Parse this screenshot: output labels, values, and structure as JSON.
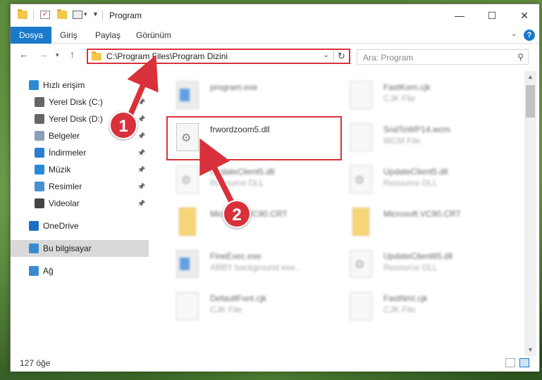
{
  "window": {
    "title": "Program",
    "controls": {
      "minimize": "—",
      "maximize": "☐",
      "close": "✕"
    }
  },
  "ribbon": {
    "tabs": [
      {
        "label": "Dosya",
        "active": true
      },
      {
        "label": "Giriş"
      },
      {
        "label": "Paylaş"
      },
      {
        "label": "Görünüm"
      }
    ],
    "help": "?"
  },
  "address": {
    "path": "C:\\Program Files\\Program Dizini",
    "search_placeholder": "Ara: Program"
  },
  "sidebar": {
    "items": [
      {
        "label": "Hızlı erişim",
        "icon": "star-icon",
        "color": "#2b8ad6",
        "pinned": false
      },
      {
        "label": "Yerel Disk (C:)",
        "icon": "drive-icon",
        "color": "#666666",
        "pinned": true
      },
      {
        "label": "Yerel Disk (D:)",
        "icon": "drive-icon",
        "color": "#666666",
        "pinned": true
      },
      {
        "label": "Belgeler",
        "icon": "documents-icon",
        "color": "#8aa0b8",
        "pinned": true
      },
      {
        "label": "İndirmeler",
        "icon": "download-icon",
        "color": "#2b7fd0",
        "pinned": true
      },
      {
        "label": "Müzik",
        "icon": "music-icon",
        "color": "#2b8ad6",
        "pinned": true
      },
      {
        "label": "Resimler",
        "icon": "pictures-icon",
        "color": "#4a8fd0",
        "pinned": true
      },
      {
        "label": "Videolar",
        "icon": "videos-icon",
        "color": "#444444",
        "pinned": true
      },
      {
        "label": "OneDrive",
        "icon": "cloud-icon",
        "color": "#1b6ec2",
        "pinned": false
      },
      {
        "label": "Bu bilgisayar",
        "icon": "computer-icon",
        "color": "#3a8ad0",
        "pinned": false,
        "selected": true
      },
      {
        "label": "Ağ",
        "icon": "network-icon",
        "color": "#3a8ad0",
        "pinned": false
      }
    ]
  },
  "files": [
    {
      "name": "program.exe",
      "type": "",
      "icon": "exe",
      "blurred": true
    },
    {
      "name": "FastKorn.cjk",
      "type": "CJK File",
      "icon": "doc",
      "blurred": true
    },
    {
      "name": "frwordzoom5.dll",
      "type": "",
      "icon": "gear",
      "blurred": false
    },
    {
      "name": "SndToWP14.wcm",
      "type": "WCM File",
      "icon": "doc",
      "blurred": true
    },
    {
      "name": "UpdateClient5.dll",
      "type": "Resource DLL",
      "icon": "gear",
      "blurred": true
    },
    {
      "name": "UpdateClient5.dll",
      "type": "Resource DLL",
      "icon": "gear",
      "blurred": true
    },
    {
      "name": "Microsoft.VC90.CRT",
      "type": "",
      "icon": "folder",
      "blurred": true
    },
    {
      "name": "Microsoft.VC90.CRT",
      "type": "",
      "icon": "folder",
      "blurred": true
    },
    {
      "name": "FineExec.exe",
      "type": "ABBY background exe...",
      "icon": "exe",
      "blurred": true
    },
    {
      "name": "UpdateClient65.dll",
      "type": "Resource DLL",
      "icon": "gear",
      "blurred": true
    },
    {
      "name": "DefaultFont.cjk",
      "type": "CJK File",
      "icon": "doc",
      "blurred": true
    },
    {
      "name": "FastNml.cjk",
      "type": "CJK File",
      "icon": "doc",
      "blurred": true
    }
  ],
  "status": {
    "count": "127 öğe"
  },
  "annotations": {
    "step1": "1",
    "step2": "2"
  },
  "colors": {
    "accent": "#1979ca",
    "highlight": "#d9313b"
  }
}
